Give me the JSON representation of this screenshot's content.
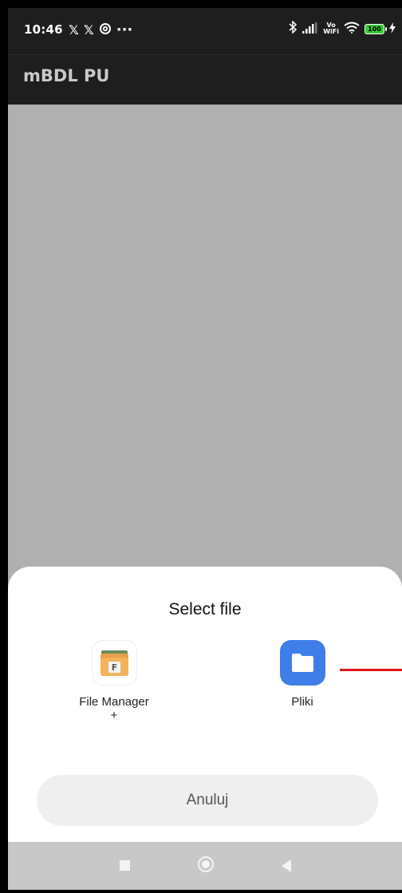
{
  "status_bar": {
    "time": "10:46",
    "left_icons": [
      "x-logo-icon",
      "x-logo-icon",
      "threads-icon",
      "more-dots-icon"
    ],
    "more_dots": "···",
    "x_glyph": "𝕏",
    "threads_glyph": "@",
    "vowifi_top": "Vo",
    "vowifi_bottom": "WiFi",
    "battery_level": "100",
    "right_icons": [
      "bluetooth-icon",
      "signal-icon",
      "vowifi-icon",
      "wifi-icon",
      "battery-icon",
      "charging-icon"
    ]
  },
  "app_bar": {
    "title": "mBDL PU"
  },
  "sheet": {
    "title": "Select file",
    "options": [
      {
        "label": "File Manager\n+",
        "label_line1": "File Manager",
        "label_line2": "+",
        "icon": "file-manager-icon"
      },
      {
        "label": "Pliki",
        "icon": "folder-icon",
        "accent": "#3f7ee8"
      }
    ],
    "cancel_label": "Anuluj"
  },
  "nav_bar": {
    "buttons": [
      "recents-icon",
      "home-icon",
      "back-icon"
    ]
  },
  "colors": {
    "status_bar_bg": "#1e1e1e",
    "scrim": "#b0b0b0",
    "sheet_bg": "#ffffff",
    "cancel_bg": "#efefef",
    "annotation": "#e0141c",
    "battery": "#38c838"
  }
}
